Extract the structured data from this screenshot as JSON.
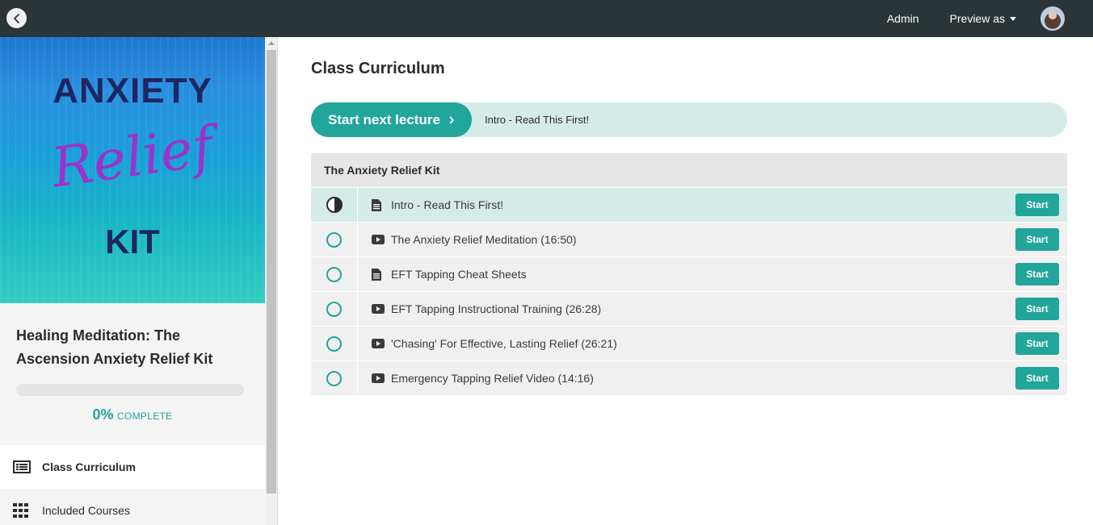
{
  "topbar": {
    "admin_label": "Admin",
    "preview_label": "Preview as"
  },
  "cover": {
    "line1": "ANXIETY",
    "line2": "Relief",
    "line3": "KIT"
  },
  "course": {
    "title": "Healing Meditation: The Ascension Anxiety Relief Kit",
    "progress_percent": 0,
    "progress_value": "0%",
    "progress_label": "COMPLETE"
  },
  "sidebar": {
    "items": [
      {
        "label": "Class Curriculum",
        "icon": "list-icon",
        "active": true
      },
      {
        "label": "Included Courses",
        "icon": "grid-icon",
        "active": false
      }
    ]
  },
  "main": {
    "title": "Class Curriculum",
    "next_button": "Start next lecture",
    "next_lecture": "Intro - Read This First!",
    "section": {
      "title": "The Anxiety Relief Kit",
      "lectures": [
        {
          "title": "Intro - Read This First!",
          "type": "document-icon",
          "status": "in-progress",
          "button": "Start"
        },
        {
          "title": "The Anxiety Relief Meditation (16:50)",
          "type": "video-icon",
          "status": "not-started",
          "button": "Start"
        },
        {
          "title": "EFT Tapping Cheat Sheets",
          "type": "document-icon",
          "status": "not-started",
          "button": "Start"
        },
        {
          "title": "EFT Tapping Instructional Training (26:28)",
          "type": "video-icon",
          "status": "not-started",
          "button": "Start"
        },
        {
          "title": "'Chasing' For Effective, Lasting Relief (26:21)",
          "type": "video-icon",
          "status": "not-started",
          "button": "Start"
        },
        {
          "title": "Emergency Tapping Relief Video (14:16)",
          "type": "video-icon",
          "status": "not-started",
          "button": "Start"
        }
      ]
    }
  },
  "colors": {
    "accent": "#22a59a",
    "topbar": "#2b3436",
    "highlight": "#d5ebe8"
  }
}
